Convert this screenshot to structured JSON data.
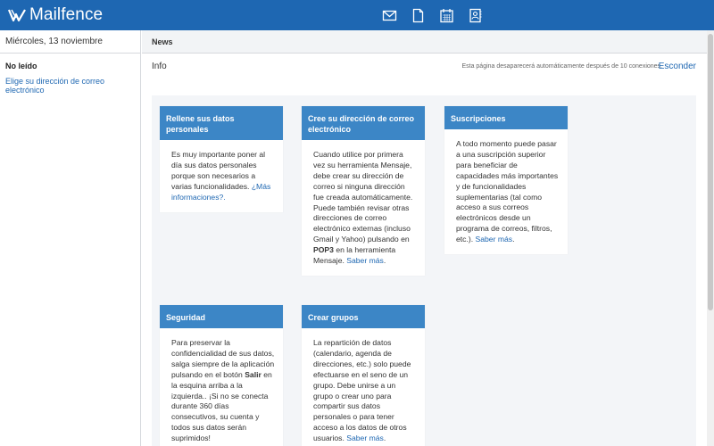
{
  "app": {
    "name": "Mailfence",
    "brand_color": "#1e67b2",
    "card_header_color": "#3c86c6"
  },
  "topbar": {
    "icons": [
      "mail-icon",
      "document-icon",
      "calendar-icon",
      "contacts-icon"
    ]
  },
  "sidebar": {
    "date": "Miércoles, 13 noviembre",
    "unread_label": "No leído",
    "choose_address_link": "Elige su dirección de correo electrónico"
  },
  "main": {
    "tab_title": "News",
    "section_title": "Info",
    "disappear_note": "Esta página desaparecerá automáticamente después de 10 conexiones.",
    "hide_link": "Esconder"
  },
  "cards": [
    {
      "title": "Rellene sus datos personales",
      "body": "Es muy importante poner al día sus datos personales porque son necesarios a varias funcionalidades. ",
      "link": "¿Más informaciones?.",
      "after": ""
    },
    {
      "title": "Cree su dirección de correo electrónico",
      "body": "Cuando utilice por primera vez su herramienta Mensaje, debe crear su dirección de correo si ninguna dirección fue creada automáticamente. Puede también revisar otras direcciones de correo electrónico externas (incluso Gmail y Yahoo) pulsando en ",
      "bold": "POP3",
      "body2": " en la herramienta Mensaje. ",
      "link": "Saber más",
      "after": "."
    },
    {
      "title": "Suscripciones",
      "body": "A todo momento puede pasar a una suscripción superior para beneficiar de capacidades más importantes y de funcionalidades suplementarias (tal como acceso a sus correos electrónicos desde un programa de correos, filtros, etc.). ",
      "link": "Saber más",
      "after": "."
    },
    {
      "title": "Seguridad",
      "body": "Para preservar la confidencialidad de sus datos, salga siempre de la aplicación pulsando en el botón ",
      "bold": "Salir",
      "body2": " en la esquina arriba a la izquierda.. ¡Si no se conecta durante 360 días consecutivos, su cuenta y todos sus datos serán suprimidos!",
      "link": "",
      "after": ""
    },
    {
      "title": "Crear grupos",
      "body": "La repartición de datos (calendario, agenda de direcciones, etc.) solo puede efectuarse en el seno de un grupo. Debe unirse a un grupo o crear uno para compartir sus datos personales o para tener acceso a los datos de otros usuarios. ",
      "link": "Saber más",
      "after": "."
    }
  ]
}
